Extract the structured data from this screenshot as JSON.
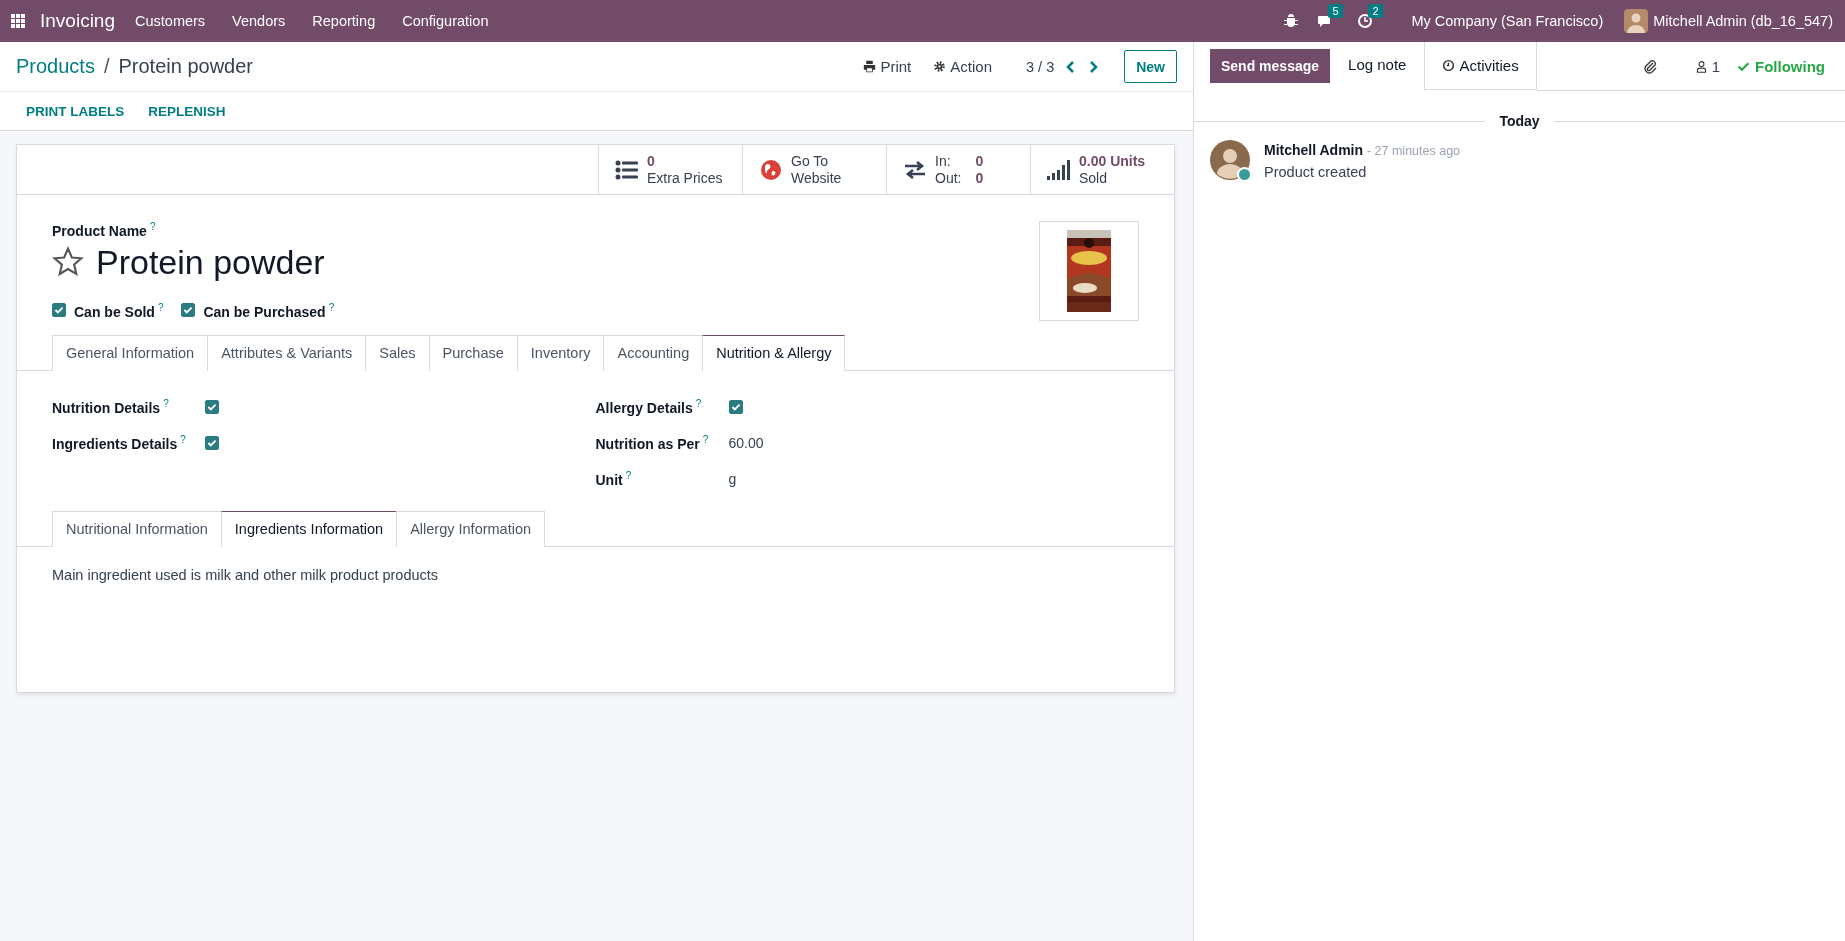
{
  "navbar": {
    "app": "Invoicing",
    "menus": [
      "Customers",
      "Vendors",
      "Reporting",
      "Configuration"
    ],
    "messages_badge": "5",
    "activities_badge": "2",
    "company": "My Company (San Francisco)",
    "user": "Mitchell Admin (db_16_547)"
  },
  "breadcrumb": {
    "parent": "Products",
    "separator": "/",
    "current": "Protein powder"
  },
  "actions": {
    "print": "Print",
    "action": "Action",
    "pager": "3 / 3",
    "new": "New"
  },
  "header_buttons": [
    "PRINT LABELS",
    "REPLENISH"
  ],
  "smart_buttons": [
    {
      "kind": "prices",
      "value": "0",
      "label": "Extra Prices"
    },
    {
      "kind": "website",
      "value": "Go To",
      "label": "Website"
    },
    {
      "kind": "moves",
      "rows": [
        {
          "label": "In:",
          "value": "0"
        },
        {
          "label": "Out:",
          "value": "0"
        }
      ]
    },
    {
      "kind": "sold",
      "value": "0.00 Units",
      "label": "Sold"
    }
  ],
  "product": {
    "name_label": "Product Name",
    "help": "?",
    "name": "Protein powder",
    "favorite": false,
    "checkboxes": [
      {
        "label": "Can be Sold",
        "help": "?",
        "checked": true
      },
      {
        "label": "Can be Purchased",
        "help": "?",
        "checked": true
      }
    ]
  },
  "tabs": [
    {
      "label": "General Information",
      "selected": false
    },
    {
      "label": "Attributes & Variants",
      "selected": false
    },
    {
      "label": "Sales",
      "selected": false
    },
    {
      "label": "Purchase",
      "selected": false
    },
    {
      "label": "Inventory",
      "selected": false
    },
    {
      "label": "Accounting",
      "selected": false
    },
    {
      "label": "Nutrition & Allergy",
      "selected": true
    }
  ],
  "fields_left": [
    {
      "kind": "checkbox",
      "label": "Nutrition Details",
      "help": "?",
      "checked": true
    },
    {
      "kind": "checkbox",
      "label": "Ingredients Details",
      "help": "?",
      "checked": true
    }
  ],
  "fields_right": [
    {
      "kind": "checkbox",
      "label": "Allergy Details",
      "help": "?",
      "checked": true
    },
    {
      "kind": "text",
      "label": "Nutrition as Per",
      "help": "?",
      "value": "60.00"
    },
    {
      "kind": "text",
      "label": "Unit",
      "help": "?",
      "value": "g"
    }
  ],
  "sub_tabs": [
    {
      "label": "Nutritional Information",
      "selected": false
    },
    {
      "label": "Ingredients Information",
      "selected": true
    },
    {
      "label": "Allergy Information",
      "selected": false
    }
  ],
  "note": "Main ingredient used is milk and other milk product products",
  "chatter": {
    "send_message": "Send message",
    "log_note": "Log note",
    "activities": "Activities",
    "followers": "1",
    "following": "Following",
    "separator": "Today",
    "messages": [
      {
        "author": "Mitchell Admin",
        "time": "- 27 minutes ago",
        "body": "Product created",
        "online": true
      }
    ]
  }
}
